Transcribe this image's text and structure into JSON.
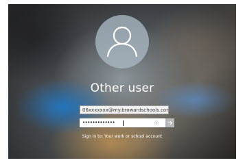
{
  "lock_screen": {
    "user_display_name": "Other user",
    "username_field": {
      "value": "06xxxxxxx@my.browardschools.com"
    },
    "password_field": {
      "masked_value": "•••••••••••••",
      "reveal_icon": "eye-icon"
    },
    "submit_icon": "arrow-right-icon",
    "sign_in_to_text": "Sign in to: Your work or school account"
  },
  "colors": {
    "avatar_circle": "#aab9c3",
    "submit_button": "#b7b7b7",
    "text": "#ffffff"
  }
}
